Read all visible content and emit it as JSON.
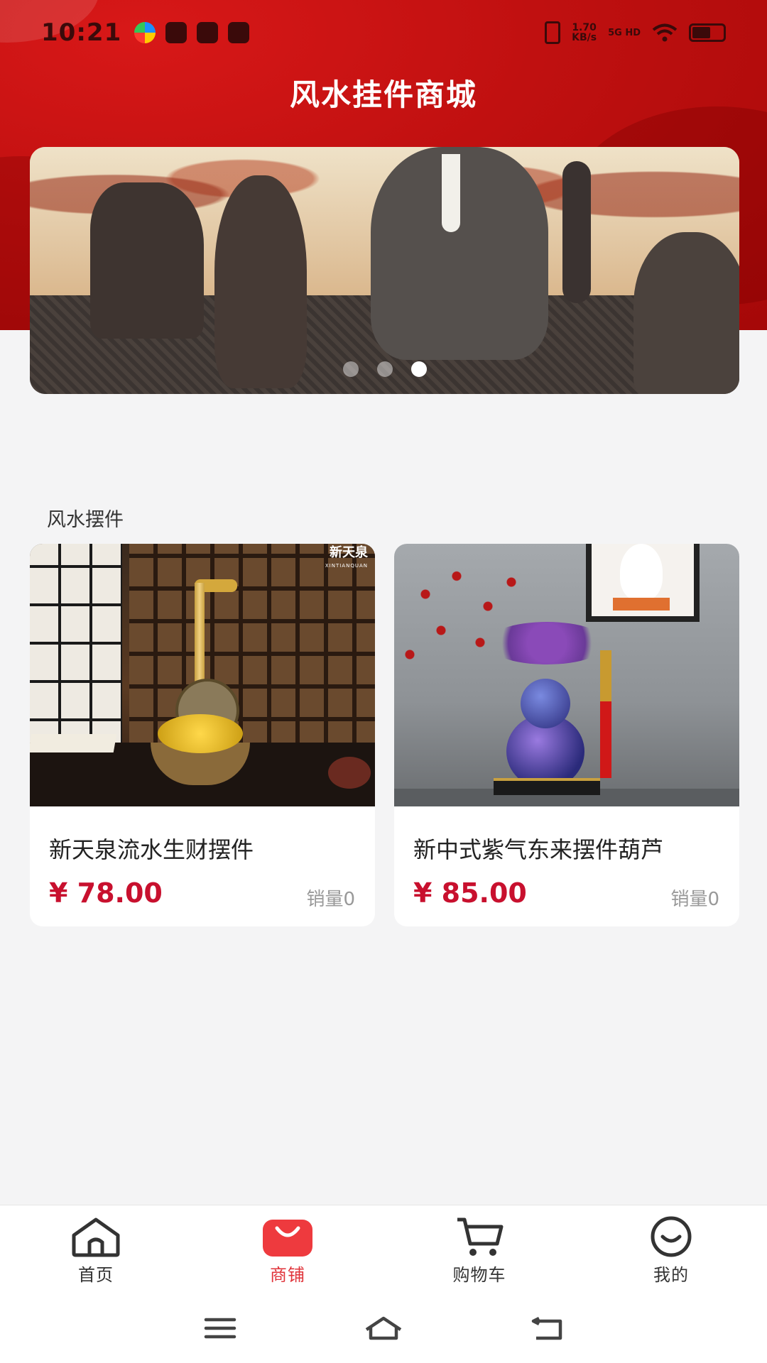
{
  "status_bar": {
    "time": "10:21",
    "net_speed": "1.70",
    "net_unit": "KB/s",
    "signal": "5G HD"
  },
  "header": {
    "title": "风水挂件商城"
  },
  "banner": {
    "slide_count": 3,
    "active_index": 2
  },
  "section": {
    "title": "风水摆件"
  },
  "products": [
    {
      "name": "新天泉流水生财摆件",
      "price": "¥ 78.00",
      "sales": "销量0",
      "image_logo": "新天泉",
      "image_logo_sub": "XINTIANQUAN"
    },
    {
      "name": "新中式紫气东来摆件葫芦",
      "price": "¥ 85.00",
      "sales": "销量0"
    }
  ],
  "tabbar": {
    "items": [
      {
        "label": "首页",
        "icon": "home-icon",
        "active": false
      },
      {
        "label": "商铺",
        "icon": "shopping-bag-icon",
        "active": true
      },
      {
        "label": "购物车",
        "icon": "cart-icon",
        "active": false
      },
      {
        "label": "我的",
        "icon": "smile-icon",
        "active": false
      }
    ]
  },
  "colors": {
    "brand_red": "#c01010",
    "price_red": "#c8102e",
    "active_tab": "#e0333a"
  }
}
